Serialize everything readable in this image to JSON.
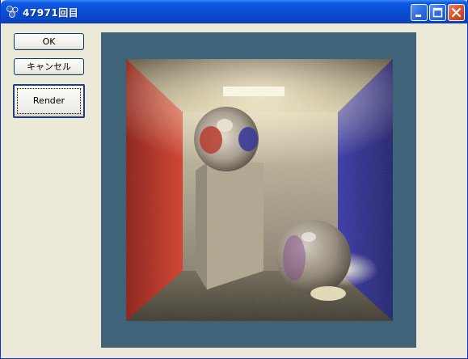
{
  "window": {
    "title": "47971回目"
  },
  "buttons": {
    "ok": "OK",
    "cancel": "キャンセル",
    "render": "Render"
  },
  "titlebar_buttons": [
    "minimize-icon",
    "maximize-icon",
    "close-icon"
  ],
  "colors": {
    "titlebar": "#0a4fd6",
    "frame": "#3f6378",
    "face": "#ece9d8",
    "left_wall": "#b3261c",
    "right_wall": "#2a2a8e"
  }
}
